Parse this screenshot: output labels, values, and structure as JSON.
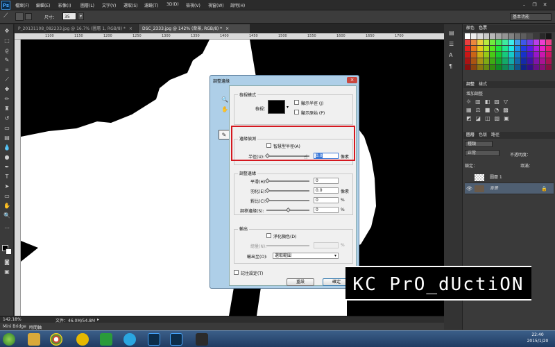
{
  "app": {
    "logo": "Ps"
  },
  "menu": [
    "檔案(F)",
    "編輯(E)",
    "影像(I)",
    "圖層(L)",
    "文字(Y)",
    "選取(S)",
    "濾鏡(T)",
    "3D(D)",
    "檢視(V)",
    "視窗(W)",
    "說明(H)"
  ],
  "options_bar": {
    "size_label": "尺寸：",
    "size_value": "35",
    "workspace": "基本功能"
  },
  "document_tabs": [
    {
      "label": "P_20131108_082233.jpg @ 16.7% (圖層 1, RGB/8) *",
      "close": "×",
      "active": false
    },
    {
      "label": "DSC_2333.jpg @ 142% (背景, RGB/8) *",
      "close": "×",
      "active": true
    }
  ],
  "ruler_numbers": [
    "1100",
    "1150",
    "1200",
    "1250",
    "1300",
    "1350",
    "1400",
    "1450",
    "1500",
    "1550",
    "1600",
    "1650",
    "1700"
  ],
  "status": {
    "zoom": "142.18%",
    "doc": "文件：46.0M/54.8M",
    "arrow": "▸"
  },
  "bottom_tabs": [
    "Mini Bridge",
    "時間軸"
  ],
  "right_panel": {
    "color_tabs": [
      "顏色",
      "色票"
    ],
    "adjust_tabs": [
      "調整",
      "樣式"
    ],
    "adjust_title": "增加調整",
    "layer_tabs": [
      "圖層",
      "色版",
      "路徑"
    ],
    "kind": "種類",
    "blend": "正常",
    "opacity_label": "不透明度：",
    "lock_label": "鎖定：",
    "fill_label": "填滿：",
    "layers": [
      {
        "name": "圖層 1"
      },
      {
        "name": "背景"
      }
    ]
  },
  "dialog": {
    "title": "調整邊緣",
    "view_mode_group": "檢視模式",
    "view_label": "檢視：",
    "show_radius": "顯示半徑 (J)",
    "show_original": "顯示原始 (P)",
    "edge_detection_group": "邊緣偵測",
    "smart_radius": "智慧型半徑(A)",
    "radius_label": "半徑(U):",
    "radius_value": "0.0",
    "radius_unit": "像素",
    "adjust_edge_group": "調整邊緣",
    "smooth_label": "平滑(H):",
    "smooth_value": "0",
    "feather_label": "羽化(E):",
    "feather_value": "0.0",
    "feather_unit": "像素",
    "contrast_label": "對比(C):",
    "contrast_value": "0",
    "contrast_unit": "%",
    "shift_label": "調移邊緣(S):",
    "shift_value": "0",
    "shift_unit": "%",
    "output_group": "輸出",
    "decontaminate": "淨化顏色(D)",
    "amount_label": "總量(N):",
    "amount_unit": "%",
    "output_to_label": "輸出至(O):",
    "output_to_value": "選取範圍",
    "remember": "記住設定(T)",
    "cancel": "重設",
    "ok": "確定",
    "close": "×"
  },
  "watermark": "KC PrO_dUctiON",
  "taskbar": {
    "time": "22:40",
    "date": "2015/1/20"
  },
  "colors": {
    "accent_red": "#d4181f",
    "ps_blue": "#46a6ff",
    "canvas_black": "#000000"
  }
}
